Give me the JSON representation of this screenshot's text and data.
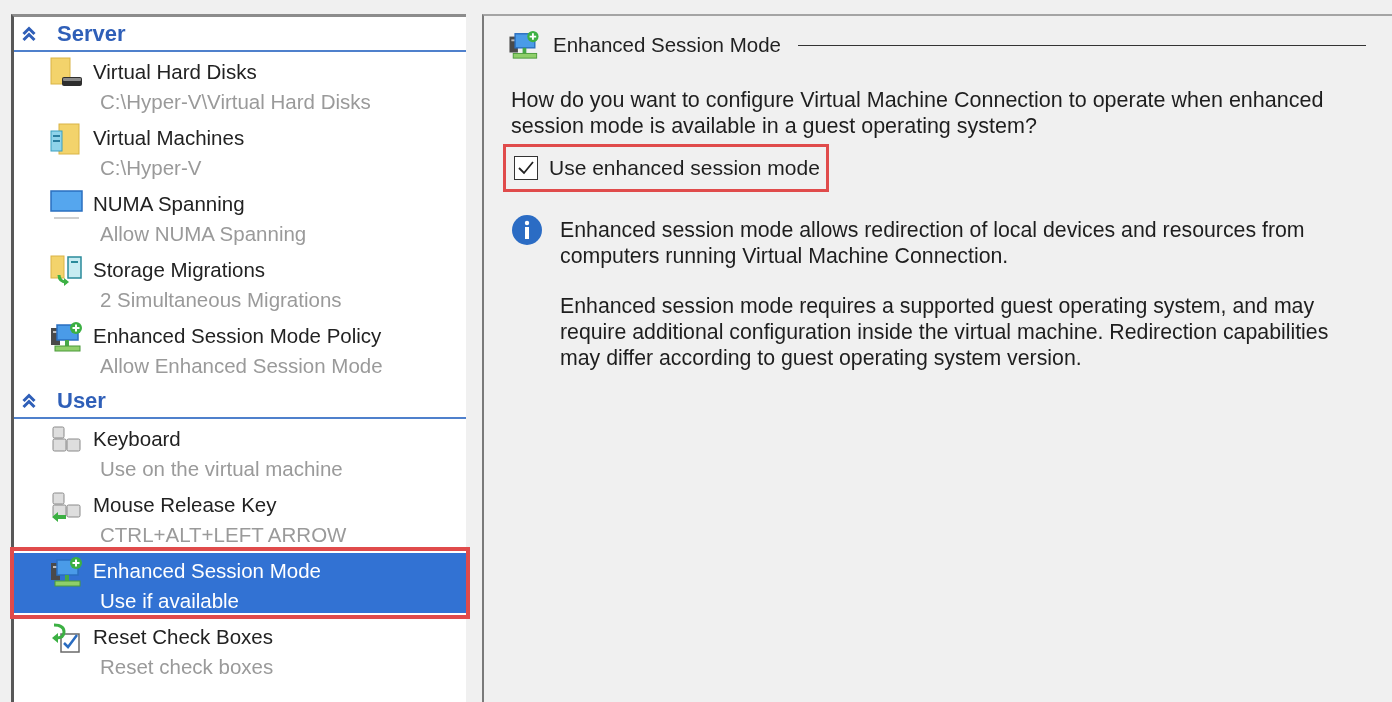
{
  "sidebar": {
    "sections": [
      {
        "title": "Server",
        "expanded": true,
        "items": [
          {
            "kind": "disks",
            "title": "Virtual Hard Disks",
            "subtitle": "C:\\Hyper-V\\Virtual Hard Disks",
            "selected": false,
            "outlined": false
          },
          {
            "kind": "machines",
            "title": "Virtual Machines",
            "subtitle": "C:\\Hyper-V",
            "selected": false,
            "outlined": false
          },
          {
            "kind": "numa",
            "title": "NUMA Spanning",
            "subtitle": "Allow NUMA Spanning",
            "selected": false,
            "outlined": false
          },
          {
            "kind": "migrations",
            "title": "Storage Migrations",
            "subtitle": "2 Simultaneous Migrations",
            "selected": false,
            "outlined": false
          },
          {
            "kind": "session",
            "title": "Enhanced Session Mode Policy",
            "subtitle": "Allow Enhanced Session Mode",
            "selected": false,
            "outlined": false
          }
        ]
      },
      {
        "title": "User",
        "expanded": true,
        "items": [
          {
            "kind": "keyboard",
            "title": "Keyboard",
            "subtitle": "Use on the virtual machine",
            "selected": false,
            "outlined": false
          },
          {
            "kind": "release-key",
            "title": "Mouse Release Key",
            "subtitle": "CTRL+ALT+LEFT ARROW",
            "selected": false,
            "outlined": false
          },
          {
            "kind": "session",
            "title": "Enhanced Session Mode",
            "subtitle": "Use if available",
            "selected": true,
            "outlined": true
          },
          {
            "kind": "reset",
            "title": "Reset Check Boxes",
            "subtitle": "Reset check boxes",
            "selected": false,
            "outlined": false
          }
        ]
      }
    ]
  },
  "detail": {
    "title": "Enhanced Session Mode",
    "question": "How do you want to configure Virtual Machine Connection to operate when enhanced session mode is available in a guest operating system?",
    "checkbox": {
      "label": "Use enhanced session mode",
      "checked": true,
      "outlined": true
    },
    "notes": [
      "Enhanced session mode allows redirection of local devices and resources from computers running Virtual Machine Connection.",
      "Enhanced session mode requires a supported guest operating system, and may require additional configuration inside the virtual machine. Redirection capabilities may differ according to guest operating system version."
    ]
  }
}
